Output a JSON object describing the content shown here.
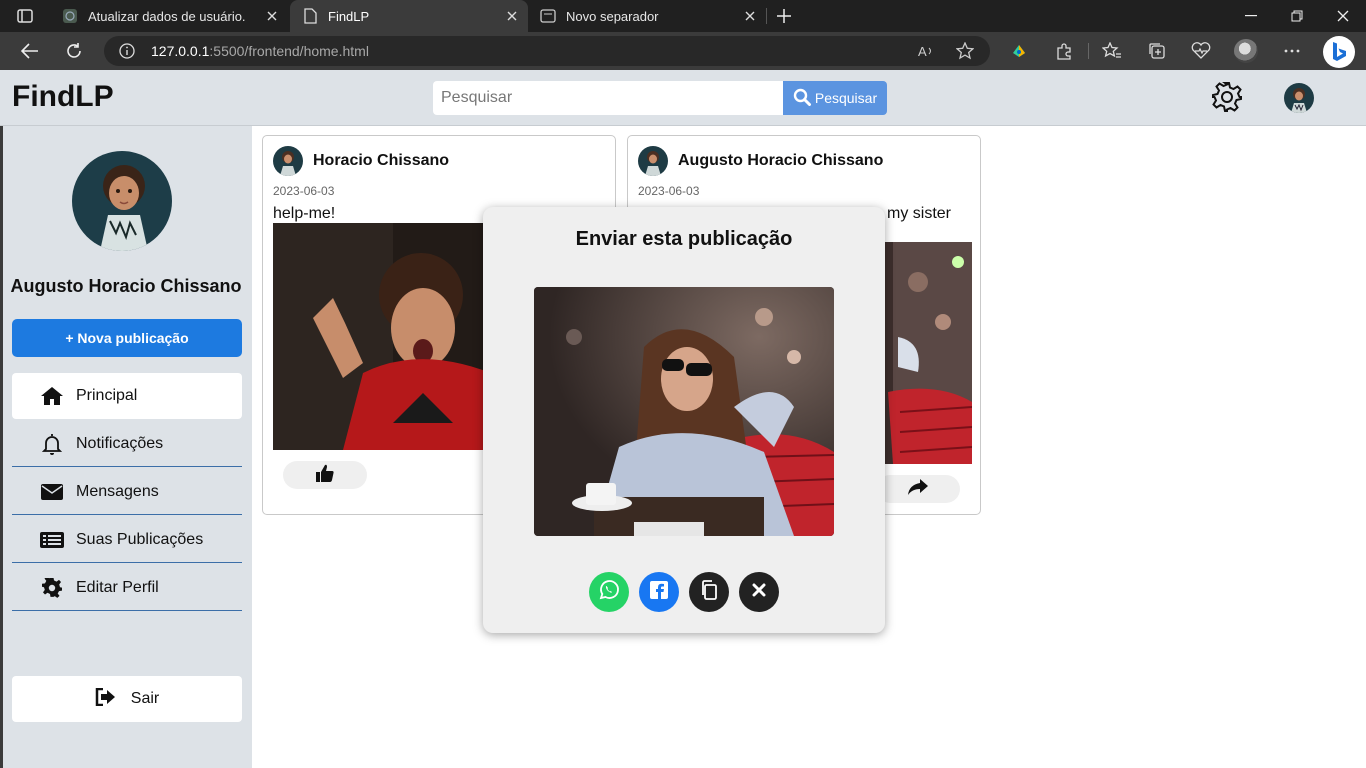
{
  "browser": {
    "tabs": [
      {
        "title": "Atualizar dados de usuário.",
        "active": false
      },
      {
        "title": "FindLP",
        "active": true
      },
      {
        "title": "Novo separador",
        "active": false
      }
    ],
    "url_host": "127.0.0.1",
    "url_rest": ":5500/frontend/home.html"
  },
  "header": {
    "logo": "FindLP",
    "search_placeholder": "Pesquisar",
    "search_button": "Pesquisar"
  },
  "sidebar": {
    "user_name": "Augusto Horacio Chissano",
    "new_post": "+ Nova publicação",
    "menu": [
      {
        "label": "Principal",
        "icon": "home-icon",
        "active": true
      },
      {
        "label": "Notificações",
        "icon": "bell-icon",
        "active": false
      },
      {
        "label": "Mensagens",
        "icon": "envelope-icon",
        "active": false
      },
      {
        "label": "Suas Publicações",
        "icon": "list-icon",
        "active": false
      },
      {
        "label": "Editar Perfil",
        "icon": "gear-icon",
        "active": false
      }
    ],
    "logout": "Sair"
  },
  "posts": [
    {
      "author": "Horacio Chissano",
      "date": "2023-06-03",
      "text": "help-me!"
    },
    {
      "author": "Augusto Horacio Chissano",
      "date": "2023-06-03",
      "text": "my sister"
    }
  ],
  "modal": {
    "title": "Enviar esta publicação",
    "actions": [
      "whatsapp-icon",
      "facebook-icon",
      "copy-icon",
      "close-icon"
    ]
  },
  "colors": {
    "primary": "#1d7ae0",
    "search_button": "#5b94e0",
    "sidebar_bg": "#dde2e7",
    "whatsapp": "#25d366",
    "facebook": "#1877f2"
  }
}
